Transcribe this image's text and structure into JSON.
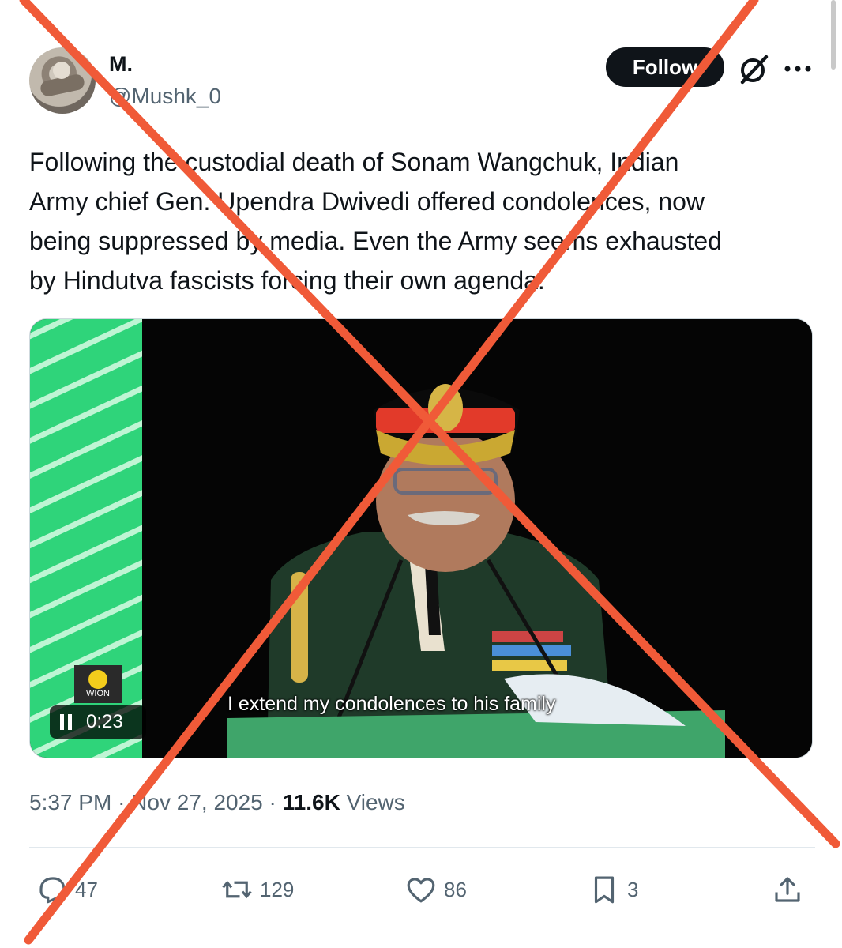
{
  "author": {
    "display_name": "M.",
    "handle": "@Mushk_0",
    "follow_label": "Follow"
  },
  "post": {
    "text_lines": [
      "Following the custodial death of Sonam Wangchuk, Indian",
      "Army chief Gen. Upendra Dwivedi offered condolences, now",
      "being suppressed by media. Even the Army seems exhausted",
      "by Hindutva fascists forcing their own agenda."
    ]
  },
  "media": {
    "caption": "I extend my condolences to his family",
    "time": "0:23",
    "logo_text": "WION"
  },
  "meta": {
    "time": "5:37 PM",
    "separator1": "·",
    "date": "Nov 27, 2025",
    "separator2": "·",
    "views_count": "11.6K",
    "views_label": "Views"
  },
  "actions": {
    "replies": "47",
    "reposts": "129",
    "likes": "86",
    "bookmarks": "3"
  },
  "icons": {
    "grok": "grok-icon",
    "more": "more-dots-icon",
    "reply": "reply-icon",
    "repost": "repost-icon",
    "like": "heart-icon",
    "bookmark": "bookmark-icon",
    "share": "share-icon",
    "pause": "pause-icon"
  },
  "colors": {
    "text": "#0f1419",
    "secondary": "#536471",
    "overlay_x": "#f05a38",
    "video_green": "#2fd47a"
  }
}
